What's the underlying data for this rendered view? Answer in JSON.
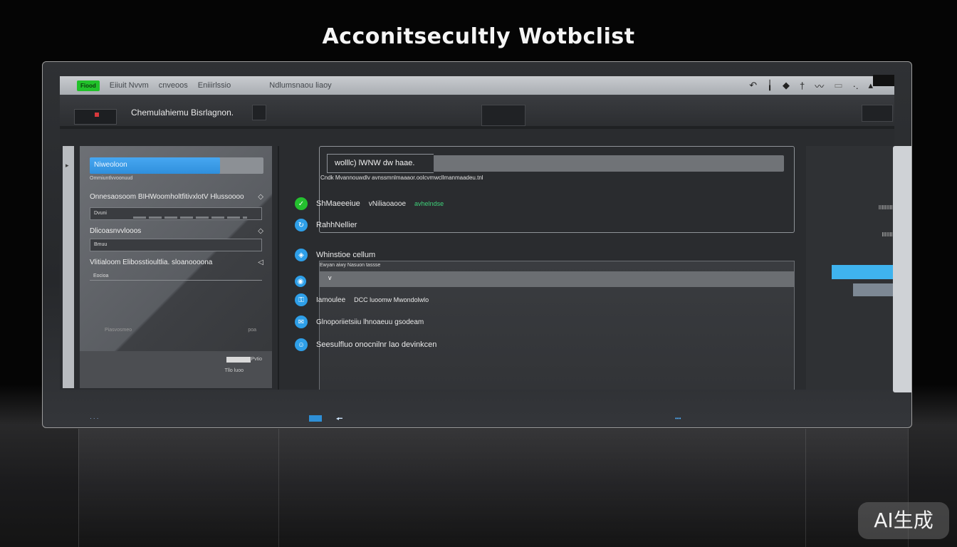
{
  "page": {
    "title": "Acconitsecultly Wotbclist"
  },
  "topbar": {
    "badge": "Fiood",
    "menu": [
      "Eiiuit Nvvm",
      "cnveoos",
      "Eniiirlssio"
    ],
    "center_menu": "Ndlumsnaou liaoy",
    "icons": [
      "undo-icon",
      "pin-icon",
      "diamond-icon",
      "pen-icon",
      "wave-icon",
      "comment-icon",
      "dots-icon",
      "arrow-up-icon"
    ]
  },
  "subheader": {
    "label": "Chemulahiemu Bisrlagnon."
  },
  "sidebar": {
    "active_item": "Niweoloon",
    "caption": "Ommiuntlvvoonuud",
    "sections": [
      {
        "label": "Onnesaosoom BIHWoomholtfitivxlotV Hlussoooo",
        "field": "Dvuni"
      },
      {
        "label": "Dlicoasnvvlooos",
        "field": "Bmuu"
      },
      {
        "label": "Vlitialoom Elibosstioultlia. sloanoooona",
        "field": "Eocioa"
      }
    ],
    "footnote_left": "Piasvosmeo",
    "footnote_right": "poa",
    "bottom_right": "Pvtio",
    "bottom_note": "Tllo luoo"
  },
  "main": {
    "search_tab": "wolllc) lWNW dw haae.",
    "hint": "Cndk Mvannouwdlv avnssmnlmaaaor.oolcvmwcllmanmaadeu.tnl",
    "rows": [
      {
        "icon": "check-icon",
        "color": "green",
        "label": "ShMaeeeiue",
        "extra": "vNiliaoaooe",
        "accent": "avhelndse"
      },
      {
        "icon": "refresh-icon",
        "color": "blue",
        "label": "RahhNellier"
      },
      {
        "icon": "shield-icon",
        "color": "blue",
        "label": "Whinstioe cellum"
      },
      {
        "icon": "lock-icon",
        "color": "blue",
        "label": ""
      },
      {
        "icon": "key-icon",
        "color": "blue",
        "label": "Iamoulee",
        "extra": "DCC luoomw Mwondolwlo"
      },
      {
        "icon": "mail-icon",
        "color": "blue",
        "label": "Glnoporiietsiiu lhnoaeuu gsodeam"
      },
      {
        "icon": "user-icon",
        "color": "blue",
        "label": "Seesulfluo onocnilnr lao devinkcen"
      }
    ],
    "section_caption": "Ewyan aiwy Nasuon tassse",
    "select_value": "v"
  },
  "right_panel": {
    "labels": [
      "IIIIIIIIII",
      "IIIIIIII"
    ]
  },
  "statusbar": {
    "left": "· · ·",
    "right": "•••"
  },
  "watermark": "AI生成"
}
